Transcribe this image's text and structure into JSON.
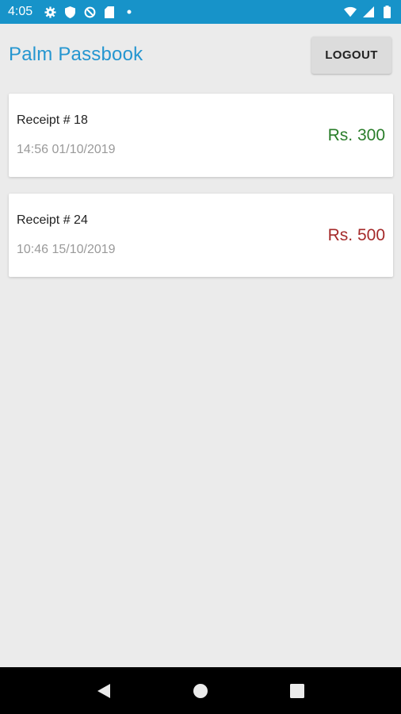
{
  "status_bar": {
    "time": "4:05",
    "icons_left": [
      "gear-icon",
      "shield-icon",
      "data-saver-icon",
      "sd-card-icon",
      "dot-icon"
    ],
    "icons_right": [
      "wifi-icon",
      "signal-icon",
      "battery-icon"
    ],
    "background": "#1793c9"
  },
  "header": {
    "title": "Palm Passbook",
    "logout_label": "LOGOUT",
    "title_color": "#2596d0"
  },
  "receipts": [
    {
      "title": "Receipt # 18",
      "datetime": "14:56 01/10/2019",
      "amount": "Rs. 300",
      "amount_color": "#2a7d2a"
    },
    {
      "title": "Receipt # 24",
      "datetime": "10:46 15/10/2019",
      "amount": "Rs. 500",
      "amount_color": "#a52a2a"
    }
  ],
  "nav_bar": {
    "buttons": [
      "back-icon",
      "home-icon",
      "recents-icon"
    ]
  }
}
